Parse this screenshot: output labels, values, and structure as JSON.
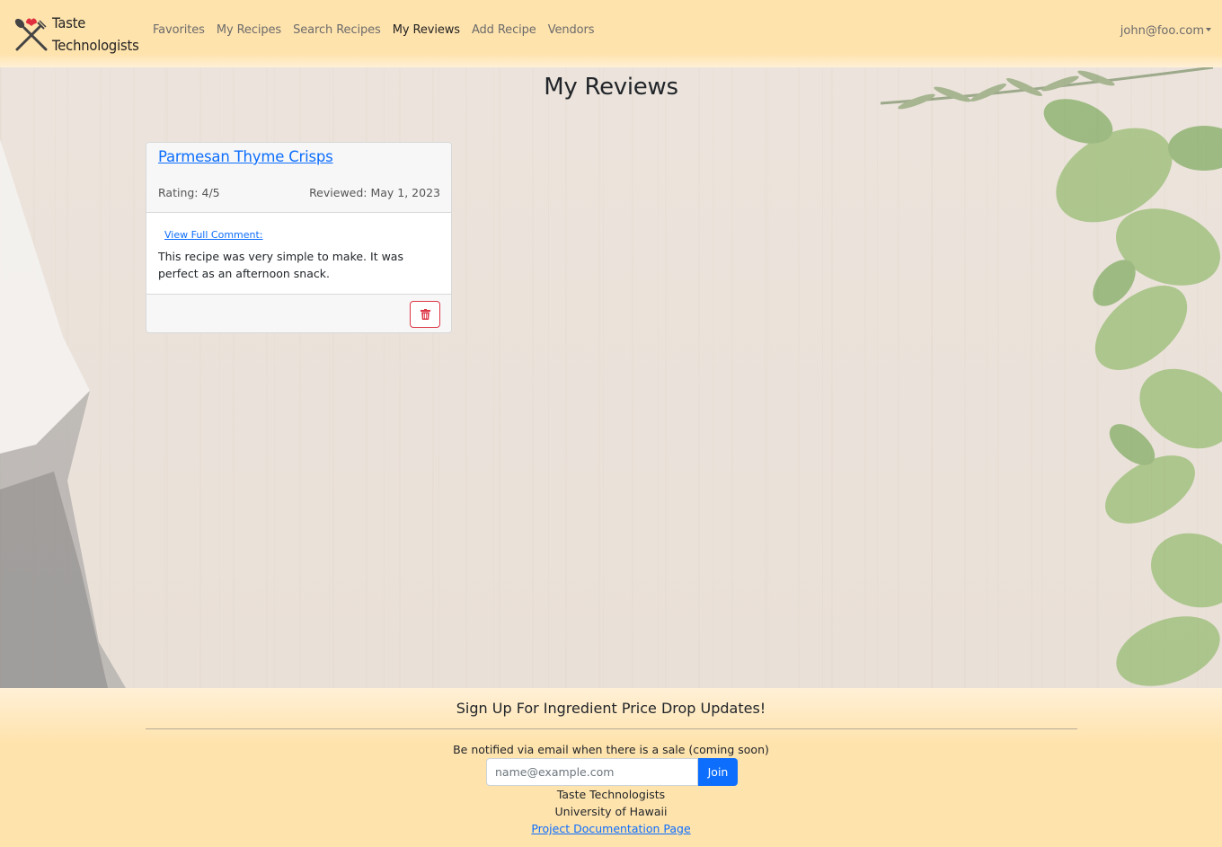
{
  "app": {
    "brand_line1": "Taste",
    "brand_line2": "Technologists"
  },
  "nav": {
    "items": [
      {
        "label": "Favorites",
        "active": false
      },
      {
        "label": "My Recipes",
        "active": false
      },
      {
        "label": "Search Recipes",
        "active": false
      },
      {
        "label": "My Reviews",
        "active": true
      },
      {
        "label": "Add Recipe",
        "active": false
      },
      {
        "label": "Vendors",
        "active": false
      }
    ],
    "user": "john@foo.com"
  },
  "page": {
    "title": "My Reviews"
  },
  "reviews": [
    {
      "recipe": "Parmesan Thyme Crisps",
      "rating": "Rating: 4/5",
      "reviewed": "Reviewed: May 1, 2023",
      "comment_link": "View Full Comment:",
      "comment": "This recipe was very simple to make. It was perfect as an afternoon snack."
    }
  ],
  "footer": {
    "title": "Sign Up For Ingredient Price Drop Updates!",
    "description": "Be notified via email when there is a sale (coming soon)",
    "email_placeholder": "name@example.com",
    "join_label": "Join",
    "org": "Taste Technologists",
    "university": "University of Hawaii",
    "doc_link": "Project Documentation Page"
  },
  "colors": {
    "primary": "#0d6efd",
    "danger": "#dc3545",
    "navbar_bg": "#ffe3ad"
  },
  "icons": {
    "logo": "fork-spoon-heart-icon",
    "delete": "trash-icon"
  }
}
